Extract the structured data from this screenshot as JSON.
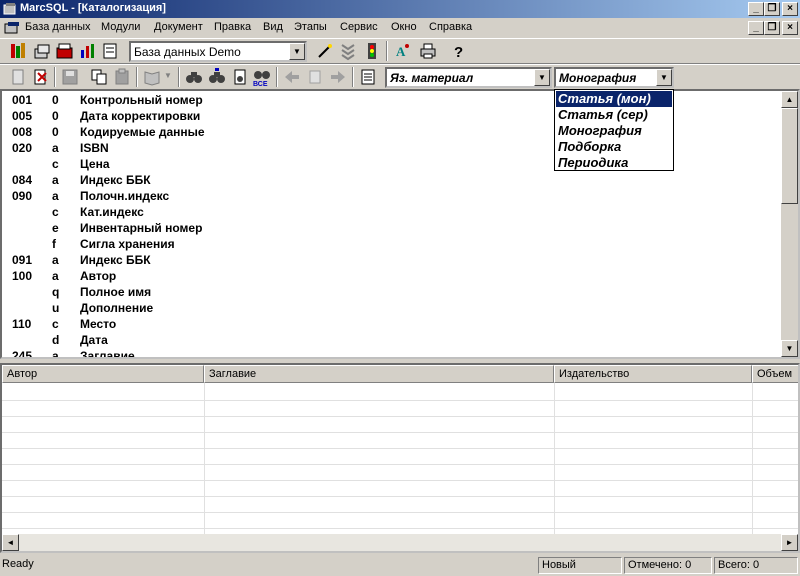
{
  "window": {
    "title": "MarcSQL - [Каталогизация]"
  },
  "menu": [
    "База данных",
    "Модули",
    "Документ",
    "Правка",
    "Вид",
    "Этапы",
    "Сервис",
    "Окно",
    "Справка"
  ],
  "toolbar": {
    "database_combo": "База данных Demo"
  },
  "toolbar2": {
    "language_combo": "Яз. материал",
    "type_combo": "Монография"
  },
  "marc_fields": [
    {
      "tag": "001",
      "sub": "0",
      "label": "Контрольный номер"
    },
    {
      "tag": "005",
      "sub": "0",
      "label": "Дата корректировки"
    },
    {
      "tag": "008",
      "sub": "0",
      "label": "Кодируемые данные"
    },
    {
      "tag": "020",
      "sub": "a",
      "label": "ISBN"
    },
    {
      "tag": "",
      "sub": "c",
      "label": "Цена"
    },
    {
      "tag": "084",
      "sub": "a",
      "label": "Индекс ББК"
    },
    {
      "tag": "090",
      "sub": "a",
      "label": "Полочн.индекс"
    },
    {
      "tag": "",
      "sub": "c",
      "label": "Кат.индекс"
    },
    {
      "tag": "",
      "sub": "e",
      "label": "Инвентарный номер"
    },
    {
      "tag": "",
      "sub": "f",
      "label": "Сигла хранения"
    },
    {
      "tag": "091",
      "sub": "a",
      "label": "Индекс ББК"
    },
    {
      "tag": "100",
      "sub": "a",
      "label": "Автор"
    },
    {
      "tag": "",
      "sub": "q",
      "label": "Полное имя"
    },
    {
      "tag": "",
      "sub": "u",
      "label": "Дополнение"
    },
    {
      "tag": "110",
      "sub": "c",
      "label": "Место"
    },
    {
      "tag": "",
      "sub": "d",
      "label": "Дата"
    },
    {
      "tag": "245",
      "sub": "a",
      "label": "Заглавие"
    }
  ],
  "dropdown": {
    "options": [
      "Статья (мон)",
      "Статья (сер)",
      "Монография",
      "Подборка",
      "Периодика"
    ],
    "highlighted": 0
  },
  "grid": {
    "columns": [
      "Автор",
      "Заглавие",
      "Издательство",
      "Объем"
    ]
  },
  "status": {
    "ready": "Ready",
    "mode": "Новый",
    "marked": "Отмечено: 0",
    "total": "Всего: 0"
  }
}
